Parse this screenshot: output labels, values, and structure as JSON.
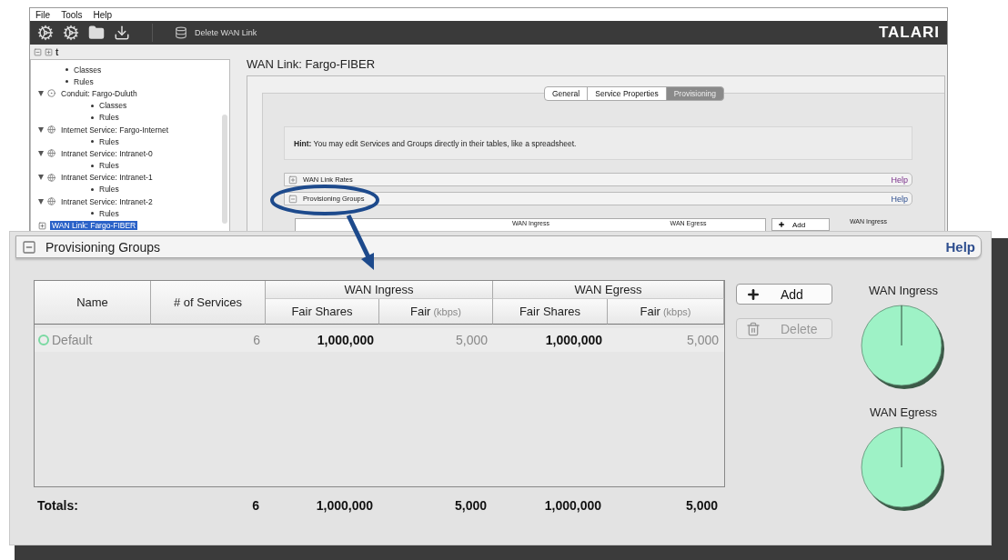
{
  "menu": [
    "File",
    "Tools",
    "Help"
  ],
  "toolbar": {
    "action": "Delete WAN Link",
    "logo": "TALARI"
  },
  "tree_tools": {
    "label": "t"
  },
  "tree": {
    "items": [
      {
        "label": "Classes",
        "kind": "leaf",
        "selected": false
      },
      {
        "label": "Rules",
        "kind": "leaf",
        "selected": false
      },
      {
        "label": "Conduit: Fargo-Duluth",
        "kind": "conduit",
        "expanded": true,
        "selected": false,
        "children": [
          {
            "label": "Classes",
            "kind": "leaf",
            "selected": false
          },
          {
            "label": "Rules",
            "kind": "leaf",
            "selected": false
          }
        ]
      },
      {
        "label": "Internet Service: Fargo-Internet",
        "kind": "service",
        "expanded": true,
        "selected": false,
        "children": [
          {
            "label": "Rules",
            "kind": "leaf",
            "selected": false
          }
        ]
      },
      {
        "label": "Intranet Service: Intranet-0",
        "kind": "service",
        "expanded": true,
        "selected": false,
        "children": [
          {
            "label": "Rules",
            "kind": "leaf",
            "selected": false
          }
        ]
      },
      {
        "label": "Intranet Service: Intranet-1",
        "kind": "service",
        "expanded": true,
        "selected": false,
        "children": [
          {
            "label": "Rules",
            "kind": "leaf",
            "selected": false
          }
        ]
      },
      {
        "label": "Intranet Service: Intranet-2",
        "kind": "service",
        "expanded": true,
        "selected": false,
        "children": [
          {
            "label": "Rules",
            "kind": "leaf",
            "selected": false
          }
        ]
      },
      {
        "label": "WAN Link: Fargo-FIBER",
        "kind": "wan_link",
        "expanded": false,
        "selected": true
      }
    ]
  },
  "page_title": "WAN Link: Fargo-FIBER",
  "tabs": [
    {
      "label": "General",
      "selected": false
    },
    {
      "label": "Service Properties",
      "selected": false
    },
    {
      "label": "Provisioning",
      "selected": true
    }
  ],
  "hint": "**Hint:** You may edit Services and Groups directly in their tables, like a spreadsheet.",
  "sections": [
    {
      "title": "WAN Link Rates",
      "expanded": false,
      "help": "Help",
      "help_visited": true
    },
    {
      "title": "Provisioning Groups",
      "expanded": true,
      "help": "Help",
      "help_visited": false
    }
  ],
  "preview": {
    "groups": [
      "WAN Ingress",
      "WAN Egress"
    ],
    "button": "Add",
    "chart_label": "WAN Ingress"
  },
  "zoom_panel": {
    "title": "Provisioning Groups",
    "expanded": true,
    "help": "Help",
    "table": {
      "columns": [
        {
          "label": "Name"
        },
        {
          "label": "# of Services"
        }
      ],
      "groups": [
        {
          "label": "WAN Ingress",
          "columns": [
            {
              "label": "Fair Shares"
            },
            {
              "label": "Fair",
              "unit": "(kbps)"
            }
          ]
        },
        {
          "label": "WAN Egress",
          "columns": [
            {
              "label": "Fair Shares"
            },
            {
              "label": "Fair",
              "unit": "(kbps)"
            }
          ]
        }
      ],
      "rows": [
        {
          "color": "#7ad9a2",
          "cells": [
            "Default",
            "6",
            "1,000,000",
            "5,000",
            "1,000,000",
            "5,000"
          ]
        }
      ],
      "totals": [
        "Totals:",
        "6",
        "1,000,000",
        "5,000",
        "1,000,000",
        "5,000"
      ]
    },
    "buttons": [
      {
        "label": "Add",
        "kind": "add",
        "disabled": false
      },
      {
        "label": "Delete",
        "kind": "delete",
        "disabled": true
      }
    ],
    "charts": [
      {
        "title": "WAN Ingress"
      },
      {
        "title": "WAN Egress"
      }
    ]
  }
}
